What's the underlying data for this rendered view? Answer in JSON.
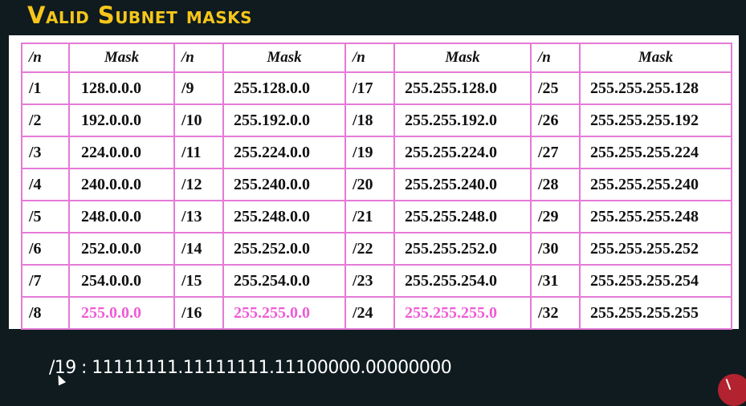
{
  "title": "Valid Subnet masks",
  "table": {
    "headers": [
      "/n",
      "Mask",
      "/n",
      "Mask",
      "/n",
      "Mask",
      "/n",
      "Mask"
    ],
    "rows": [
      [
        {
          "n": "/1",
          "mask": "128.0.0.0"
        },
        {
          "n": "/9",
          "mask": "255.128.0.0"
        },
        {
          "n": "/17",
          "mask": "255.255.128.0"
        },
        {
          "n": "/25",
          "mask": "255.255.255.128"
        }
      ],
      [
        {
          "n": "/2",
          "mask": "192.0.0.0"
        },
        {
          "n": "/10",
          "mask": "255.192.0.0"
        },
        {
          "n": "/18",
          "mask": "255.255.192.0"
        },
        {
          "n": "/26",
          "mask": "255.255.255.192"
        }
      ],
      [
        {
          "n": "/3",
          "mask": "224.0.0.0"
        },
        {
          "n": "/11",
          "mask": "255.224.0.0"
        },
        {
          "n": "/19",
          "mask": "255.255.224.0"
        },
        {
          "n": "/27",
          "mask": "255.255.255.224"
        }
      ],
      [
        {
          "n": "/4",
          "mask": "240.0.0.0"
        },
        {
          "n": "/12",
          "mask": "255.240.0.0"
        },
        {
          "n": "/20",
          "mask": "255.255.240.0"
        },
        {
          "n": "/28",
          "mask": "255.255.255.240"
        }
      ],
      [
        {
          "n": "/5",
          "mask": "248.0.0.0"
        },
        {
          "n": "/13",
          "mask": "255.248.0.0"
        },
        {
          "n": "/21",
          "mask": "255.255.248.0"
        },
        {
          "n": "/29",
          "mask": "255.255.255.248"
        }
      ],
      [
        {
          "n": "/6",
          "mask": "252.0.0.0"
        },
        {
          "n": "/14",
          "mask": "255.252.0.0"
        },
        {
          "n": "/22",
          "mask": "255.255.252.0"
        },
        {
          "n": "/30",
          "mask": "255.255.255.252"
        }
      ],
      [
        {
          "n": "/7",
          "mask": "254.0.0.0"
        },
        {
          "n": "/15",
          "mask": "255.254.0.0"
        },
        {
          "n": "/23",
          "mask": "255.255.254.0"
        },
        {
          "n": "/31",
          "mask": "255.255.255.254"
        }
      ],
      [
        {
          "n": "/8",
          "mask": "255.0.0.0",
          "highlight": true
        },
        {
          "n": "/16",
          "mask": "255.255.0.0",
          "highlight": true
        },
        {
          "n": "/24",
          "mask": "255.255.255.0",
          "highlight": true
        },
        {
          "n": "/32",
          "mask": "255.255.255.255"
        }
      ]
    ]
  },
  "binary_line": "/19 : 11111111.11111111.11100000.00000000",
  "colors": {
    "background": "#0f1b1f",
    "title": "#f6c61a",
    "table_border": "#e57ad7",
    "highlight": "#ef5cd6"
  },
  "icons": [
    "cursor-icon",
    "corner-badge"
  ]
}
